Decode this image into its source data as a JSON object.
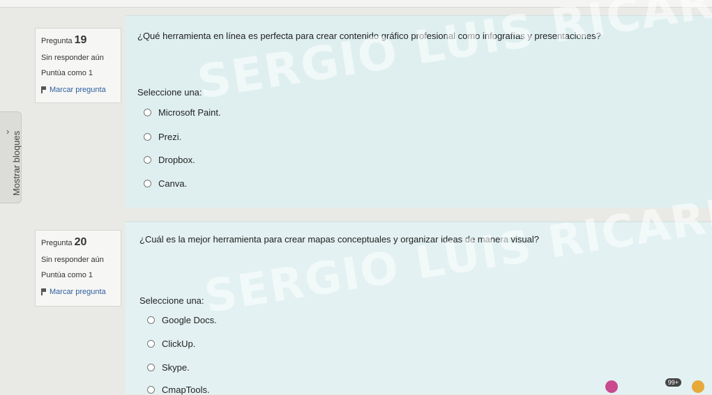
{
  "sidebar": {
    "toggle_label": "Mostrar bloques"
  },
  "questions": [
    {
      "label": "Pregunta",
      "number": "19",
      "status": "Sin responder aún",
      "score": "Puntúa como 1",
      "flag": "Marcar pregunta",
      "text": "¿Qué herramienta en línea es perfecta para crear contenido gráfico profesional como infografías y presentaciones?",
      "select_label": "Seleccione una:",
      "options": [
        "Microsoft Paint.",
        "Prezi.",
        "Dropbox.",
        "Canva."
      ]
    },
    {
      "label": "Pregunta",
      "number": "20",
      "status": "Sin responder aún",
      "score": "Puntúa como 1",
      "flag": "Marcar pregunta",
      "text": "¿Cuál es la mejor herramienta para crear mapas conceptuales y organizar ideas de manera visual?",
      "select_label": "Seleccione una:",
      "options": [
        "Google Docs.",
        "ClickUp.",
        "Skype.",
        "CmapTools."
      ]
    }
  ],
  "watermark": {
    "text1": "SERGIO LUIS RICARDO QUIN",
    "text2": "SERGIO LUIS RICARDO QUI"
  },
  "taskbar": {
    "badge": "99+"
  }
}
